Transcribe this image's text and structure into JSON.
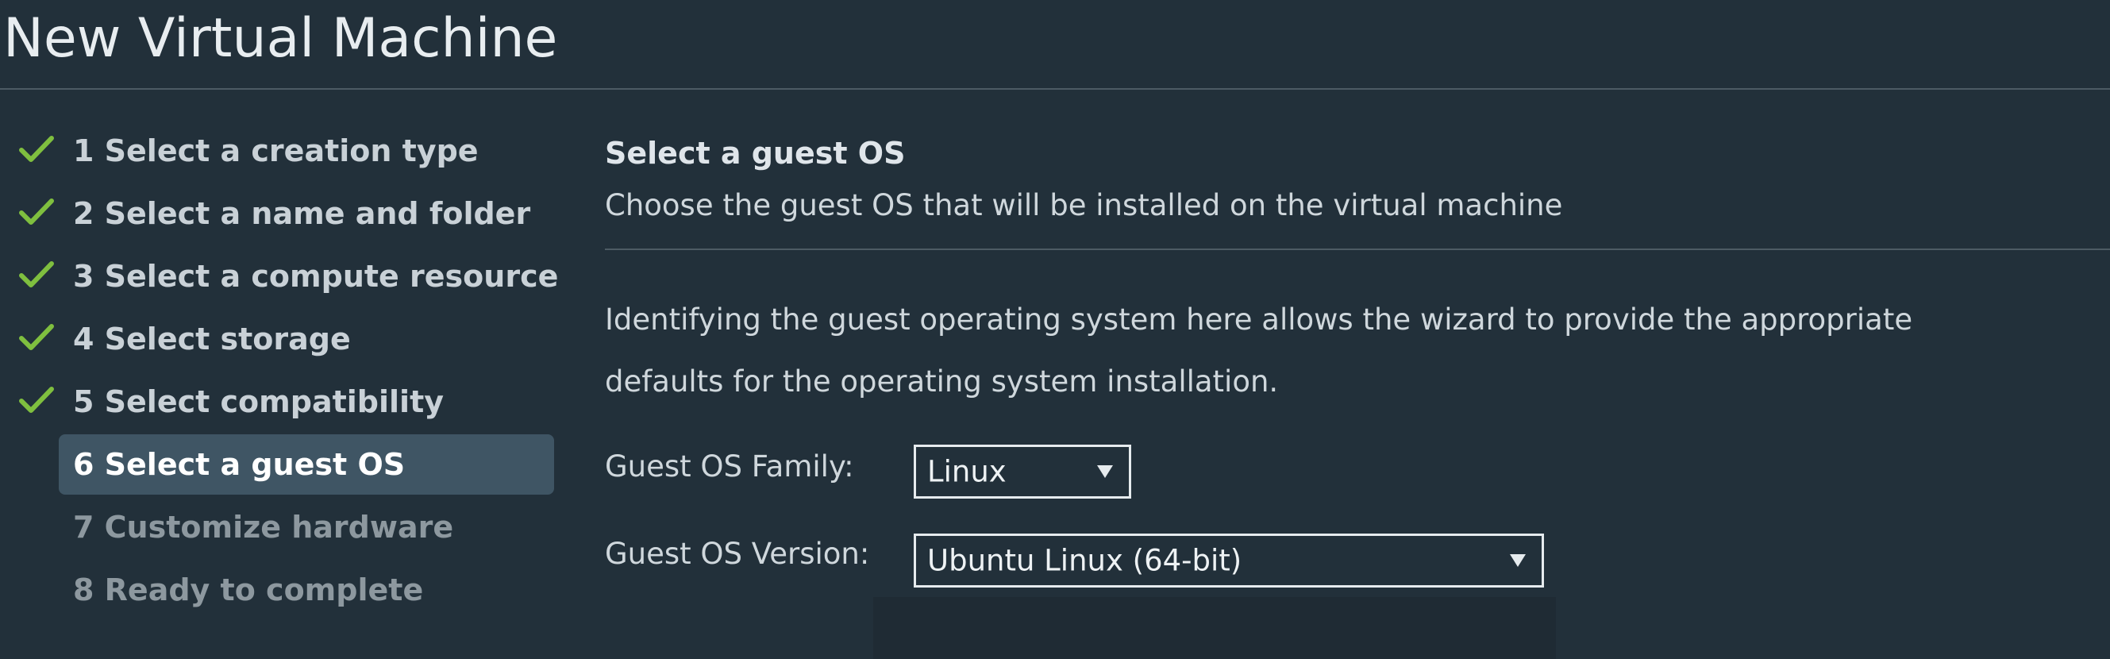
{
  "dialog": {
    "title": "New Virtual Machine"
  },
  "steps": [
    {
      "label": "1 Select a creation type",
      "status": "completed"
    },
    {
      "label": "2 Select a name and folder",
      "status": "completed"
    },
    {
      "label": "3 Select a compute resource",
      "status": "completed"
    },
    {
      "label": "4 Select storage",
      "status": "completed"
    },
    {
      "label": "5 Select compatibility",
      "status": "completed"
    },
    {
      "label": "6 Select a guest OS",
      "status": "current"
    },
    {
      "label": "7 Customize hardware",
      "status": "pending"
    },
    {
      "label": "8 Ready to complete",
      "status": "pending"
    }
  ],
  "content": {
    "title": "Select a guest OS",
    "subtitle": "Choose the guest OS that will be installed on the virtual machine",
    "description_line1": "Identifying the guest operating system here allows the wizard to provide the appropriate",
    "description_line2": "defaults for the operating system installation.",
    "os_family": {
      "label": "Guest OS Family:",
      "value": "Linux"
    },
    "os_version": {
      "label": "Guest OS Version:",
      "value": "Ubuntu Linux (64-bit)"
    }
  },
  "colors": {
    "background": "#22303a",
    "check": "#7fbf3f",
    "current_step_bg": "#3f5564"
  },
  "icons": {
    "completed_step": "check-icon",
    "dropdown": "triangle-down-icon"
  }
}
